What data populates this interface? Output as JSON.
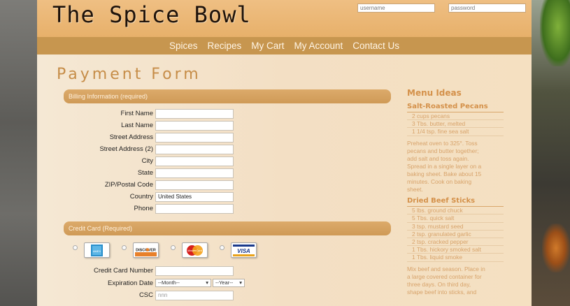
{
  "header": {
    "logo": "The Spice Bowl",
    "username_placeholder": "username",
    "password_placeholder": "password"
  },
  "nav": [
    "Spices",
    "Recipes",
    "My Cart",
    "My Account",
    "Contact Us"
  ],
  "page_title": "Payment Form",
  "billing": {
    "heading": "Billing Information (required)",
    "fields": [
      {
        "label": "First Name",
        "value": ""
      },
      {
        "label": "Last Name",
        "value": ""
      },
      {
        "label": "Street Address",
        "value": ""
      },
      {
        "label": "Street Address (2)",
        "value": ""
      },
      {
        "label": "City",
        "value": ""
      },
      {
        "label": "State",
        "value": ""
      },
      {
        "label": "ZIP/Postal Code",
        "value": ""
      },
      {
        "label": "Country",
        "value": "United States"
      },
      {
        "label": "Phone",
        "value": ""
      }
    ]
  },
  "credit": {
    "heading": "Credit Card (Required)",
    "cards": [
      "AMEX",
      "DISCOVER",
      "MasterCard",
      "VISA"
    ],
    "card_number_label": "Credit Card Number",
    "expiration_label": "Expiration Date",
    "month_selected": "--Month--",
    "year_selected": "--Year--",
    "csc_label": "CSC",
    "csc_placeholder": "nnn"
  },
  "sidebar": {
    "heading": "Menu Ideas",
    "recipes": [
      {
        "title": "Salt-Roasted Pecans",
        "ingredients": [
          "2 cups pecans",
          "3 Tbs. butter, melted",
          "1 1/4 tsp. fine sea salt"
        ],
        "instructions": [
          "Preheat oven to 325°. Toss",
          "pecans and butter together;",
          "add salt and toss again.",
          "Spread in a single layer on a",
          "baking sheet. Bake about 15",
          "minutes. Cook on baking",
          "sheet."
        ]
      },
      {
        "title": "Dried Beef Sticks",
        "ingredients": [
          "5 lbs. ground chuck",
          "5 Tbs. quick salt",
          "3 tsp. mustard seed",
          "2 tsp. granulated garlic",
          "2 tsp. cracked pepper",
          "1 Tbs. hickory smoked salt",
          "1 Tbs. liquid smoke"
        ],
        "instructions": [
          "Mix beef and season. Place in",
          "a large covered container for",
          "three days. On third day,",
          "shape beef into sticks, and"
        ]
      }
    ]
  },
  "colors": {
    "header_bg": "#e9b16d",
    "nav_bg": "#c7964f",
    "accent_text": "#d4914a",
    "section_bar": "#d5a15f"
  }
}
